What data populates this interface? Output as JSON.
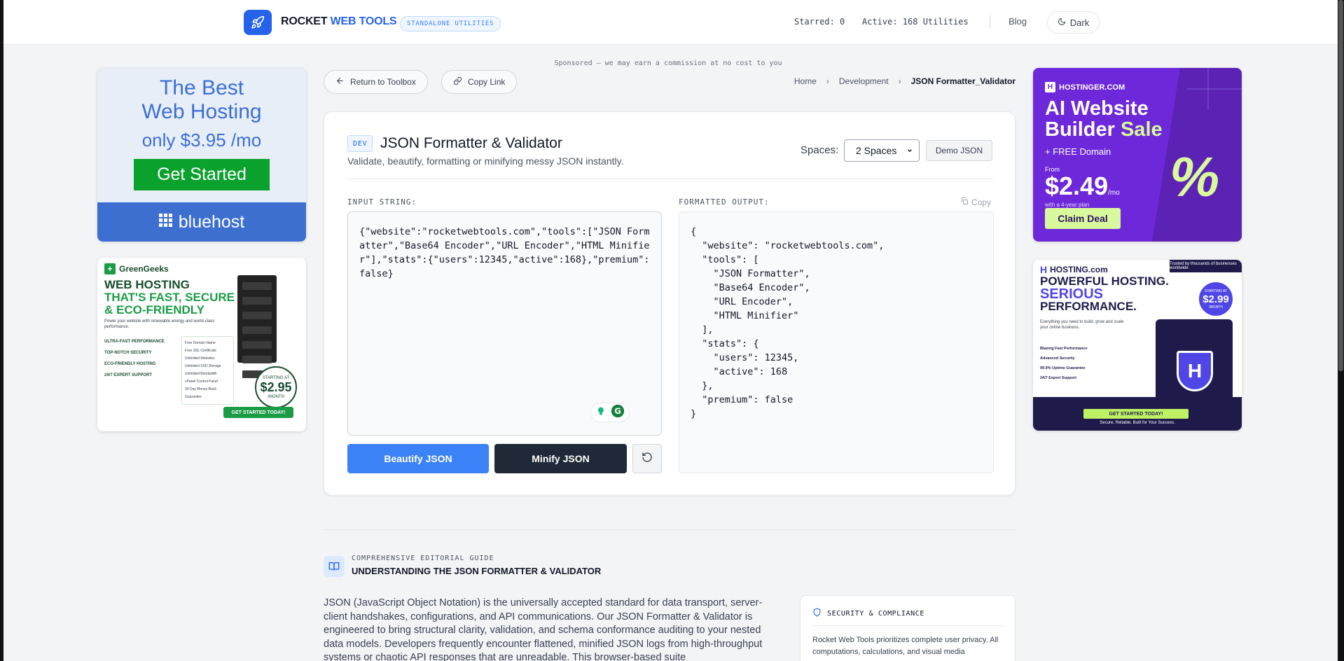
{
  "header": {
    "brand_a": "ROCKET",
    "brand_b": "WEB TOOLS",
    "badge": "STANDALONE UTILITIES",
    "starred": "Starred: 0",
    "active": "Active: 168 Utilities",
    "blog": "Blog",
    "theme": "Dark"
  },
  "sponsored_note": "Sponsored — we may earn a commission at no cost to you",
  "toolbar": {
    "return_label": "Return to Toolbox",
    "copy_link_label": "Copy Link"
  },
  "breadcrumb": [
    "Home",
    "Development",
    "JSON Formatter_Validator"
  ],
  "tool": {
    "badge": "DEV",
    "title": "JSON Formatter & Validator",
    "subtitle": "Validate, beautify, formatting or minifying messy JSON instantly.",
    "spaces_label": "Spaces:",
    "spaces_value": "2 Spaces",
    "demo_label": "Demo JSON",
    "input_label": "INPUT STRING:",
    "output_label": "FORMATTED OUTPUT:",
    "copy_label": "Copy",
    "input_value": "{\"website\":\"rocketwebtools.com\",\"tools\":[\"JSON Formatter\",\"Base64 Encoder\",\"URL Encoder\",\"HTML Minifier\"],\"stats\":{\"users\":12345,\"active\":168},\"premium\":false}",
    "output_value": "{\n  \"website\": \"rocketwebtools.com\",\n  \"tools\": [\n    \"JSON Formatter\",\n    \"Base64 Encoder\",\n    \"URL Encoder\",\n    \"HTML Minifier\"\n  ],\n  \"stats\": {\n    \"users\": 12345,\n    \"active\": 168\n  },\n  \"premium\": false\n}",
    "beautify_label": "Beautify JSON",
    "minify_label": "Minify JSON"
  },
  "guide": {
    "kicker": "COMPREHENSIVE EDITORIAL GUIDE",
    "title": "UNDERSTANDING THE JSON FORMATTER & VALIDATOR",
    "body": "JSON (JavaScript Object Notation) is the universally accepted standard for data transport, server-client handshakes, configurations, and API communications. Our JSON Formatter & Validator is engineered to bring structural clarity, validation, and schema conformance auditing to your nested data models. Developers frequently encounter flattened, minified JSON logs from high-throughput systems or chaotic API responses that are unreadable. This browser-based suite"
  },
  "security": {
    "title": "SECURITY & COMPLIANCE",
    "body": "Rocket Web Tools prioritizes complete user privacy. All computations, calculations, and visual media"
  },
  "ads": {
    "bluehost": {
      "line1": "The Best",
      "line2": "Web Hosting",
      "price": "only  $3.95 /mo",
      "cta": "Get Started",
      "brand": "bluehost"
    },
    "greengeeks": {
      "brand": "GreenGeeks",
      "head1": "WEB HOSTING",
      "head2": "THAT'S FAST, SECURE",
      "head3": "& ECO-FRIENDLY",
      "sub": "Power your website with renewable energy and world-class performance.",
      "features": [
        "ULTRA-FAST PERFORMANCE",
        "TOP-NOTCH SECURITY",
        "ECO-FRIENDLY HOSTING",
        "24/7 EXPERT SUPPORT"
      ],
      "plan_items": [
        "Free Domain Name",
        "Free SSL Certificate",
        "Unlimited Websites",
        "Unlimited SSD Storage",
        "Unlimited Bandwidth",
        "cPanel Control Panel",
        "30 Day Money-Back Guarantee"
      ],
      "price_prefix": "STARTING AT",
      "price": "$2.95",
      "price_suffix": "/MONTH",
      "cta": "GET STARTED TODAY!"
    },
    "hostinger": {
      "brand": "HOSTINGER.COM",
      "head1": "AI Website",
      "head2a": "Builder ",
      "head2b": "Sale",
      "free": "+ FREE Domain",
      "from": "From",
      "price": "$2.49",
      "per": "/mo",
      "plan": "with a 4-year plan",
      "cta": "Claim Deal"
    },
    "hostingcom": {
      "brand": "HOSTING.com",
      "trust": "Trusted by thousands of businesses worldwide",
      "head1": "POWERFUL HOSTING.",
      "head2": "SERIOUS",
      "head3": "PERFORMANCE.",
      "sub": "Everything you need to build, grow and scale your online business.",
      "price_prefix": "STARTING AT",
      "price": "$2.99",
      "price_suffix": "/MONTH",
      "features": [
        "Blazing Fast Performance",
        "Advanced Security",
        "99.9% Uptime Guarantee",
        "24/7 Expert Support"
      ],
      "cta": "GET STARTED TODAY!",
      "secure": "Secure. Reliable. Built for Your Success."
    }
  }
}
